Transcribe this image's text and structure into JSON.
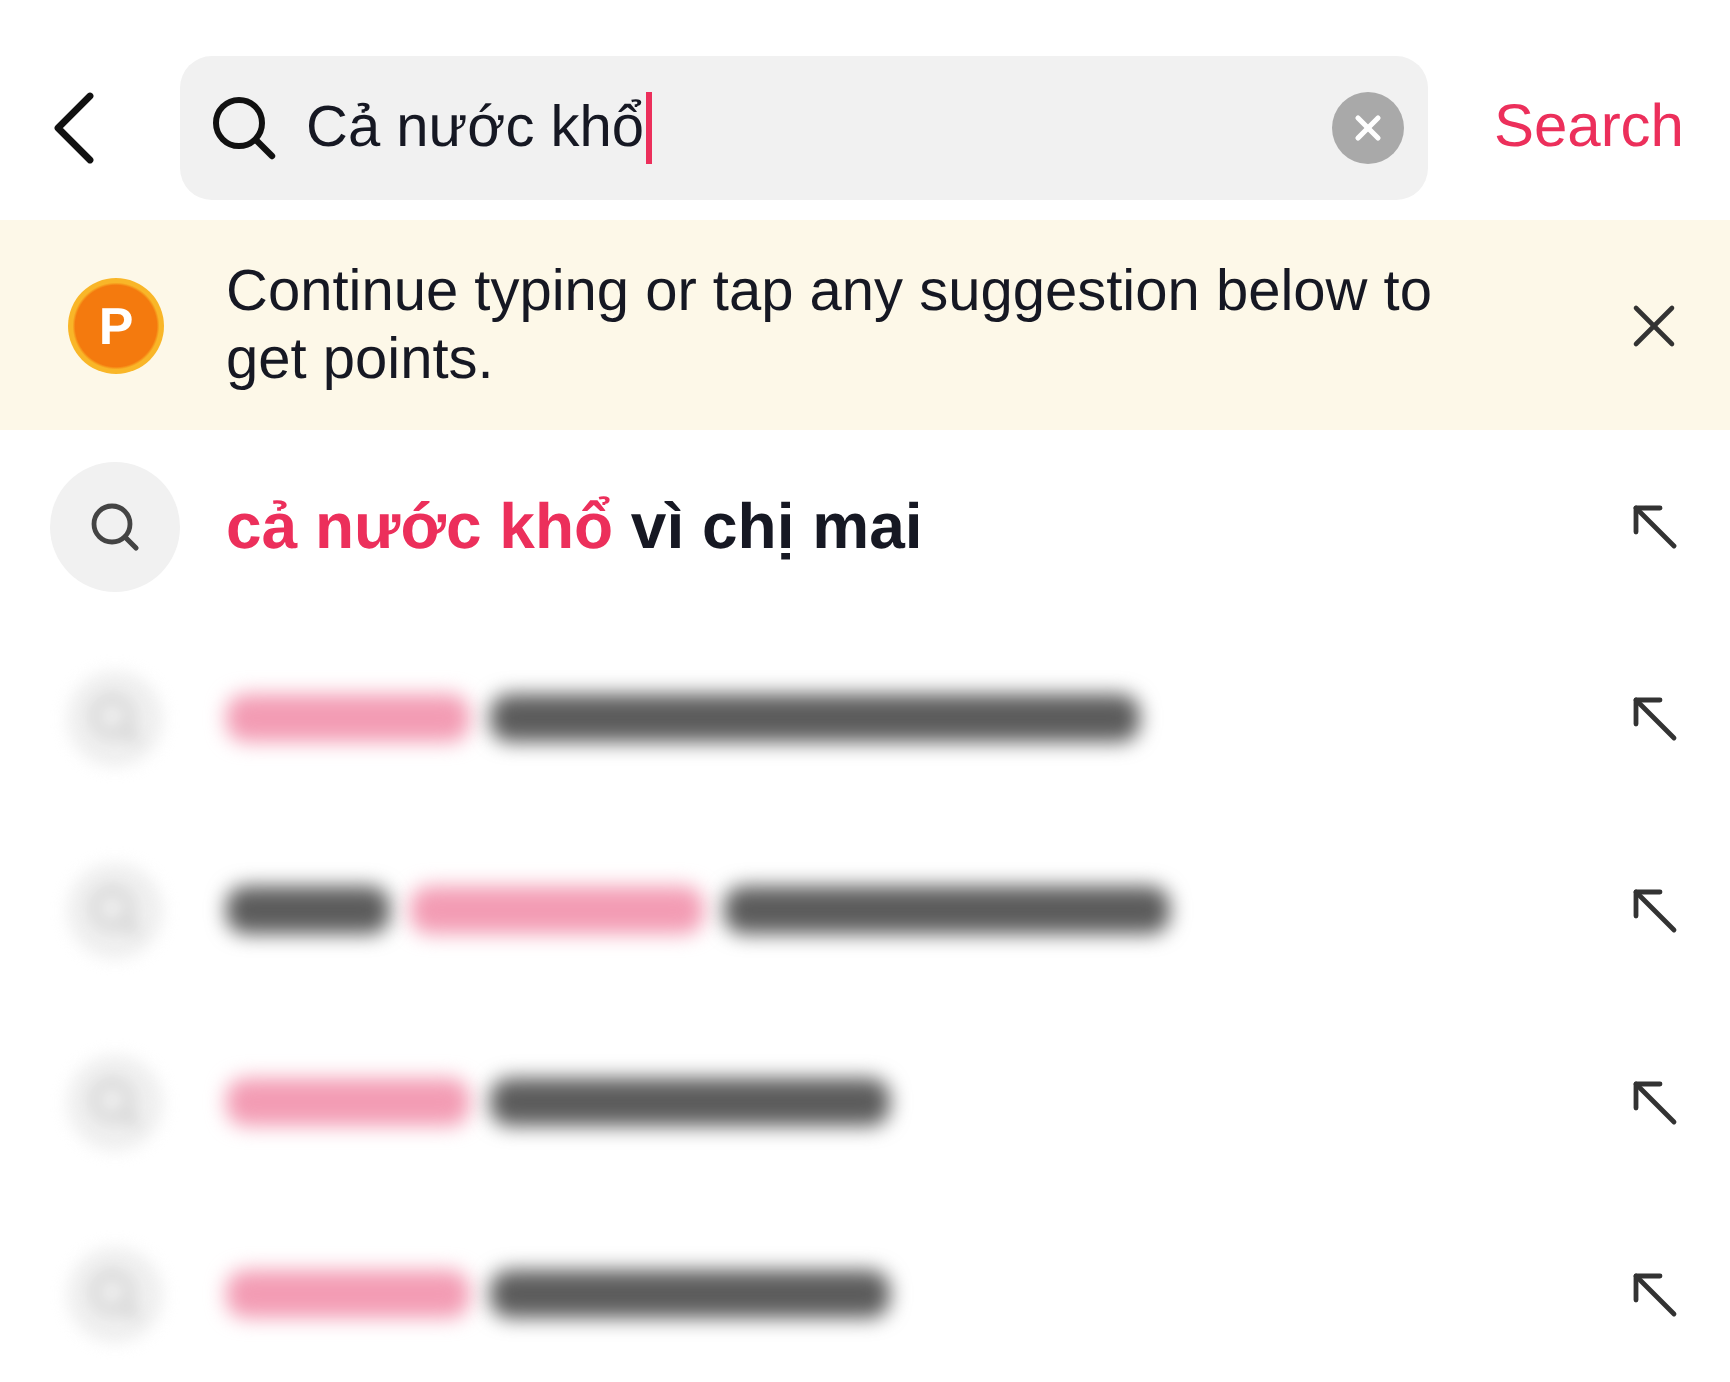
{
  "search": {
    "value": "Cả nước khổ",
    "focused": true,
    "button": "Search"
  },
  "banner": {
    "badge": "P",
    "message": "Continue typing or tap any suggestion below to get points."
  },
  "suggestions": [
    {
      "kind": "plain",
      "segments": [
        {
          "kind": "match",
          "text": "cả nước khổ"
        },
        {
          "kind": "rest",
          "text": " vì chị mai"
        }
      ]
    },
    {
      "kind": "blurred",
      "segments": [
        {
          "kind": "match"
        },
        {
          "kind": "rest"
        }
      ]
    },
    {
      "kind": "blurred",
      "segments": [
        {
          "kind": "rest"
        },
        {
          "kind": "match"
        },
        {
          "kind": "rest"
        }
      ]
    },
    {
      "kind": "blurred",
      "segments": [
        {
          "kind": "match"
        },
        {
          "kind": "rest"
        }
      ]
    },
    {
      "kind": "blurred",
      "segments": [
        {
          "kind": "match"
        },
        {
          "kind": "rest"
        }
      ]
    }
  ]
}
